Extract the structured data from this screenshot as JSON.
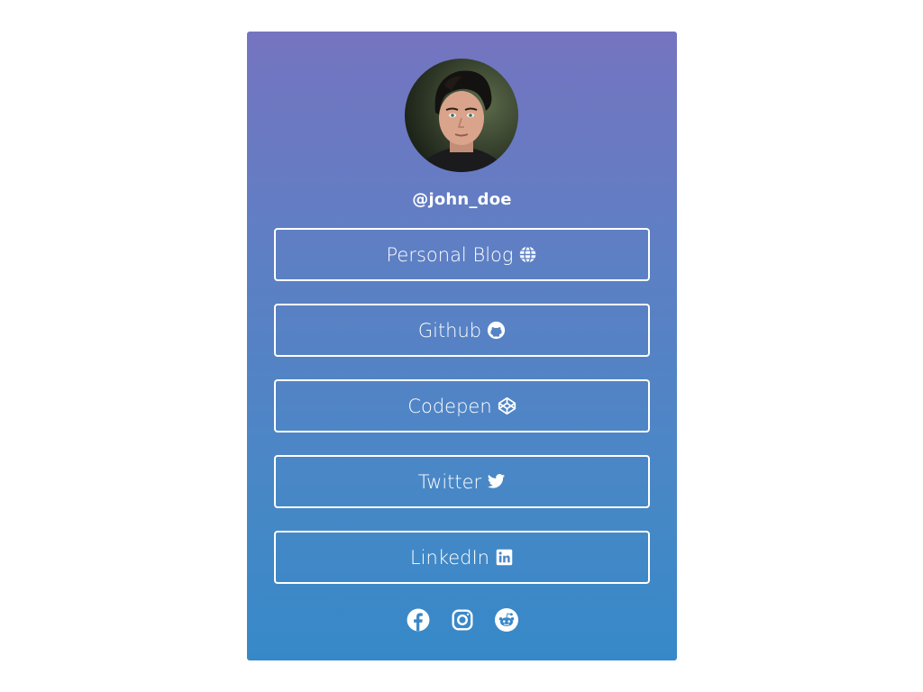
{
  "profile": {
    "username": "@john_doe",
    "avatar_alt": "profile photo"
  },
  "links": [
    {
      "label": "Personal Blog",
      "icon": "globe-icon"
    },
    {
      "label": "Github",
      "icon": "github-icon"
    },
    {
      "label": "Codepen",
      "icon": "codepen-icon"
    },
    {
      "label": "Twitter",
      "icon": "twitter-icon"
    },
    {
      "label": "LinkedIn",
      "icon": "linkedin-icon"
    }
  ],
  "social": [
    {
      "icon": "facebook-icon"
    },
    {
      "icon": "instagram-icon"
    },
    {
      "icon": "reddit-icon"
    }
  ],
  "colors": {
    "gradient_top": "#7574c0",
    "gradient_bottom": "#3689c8",
    "foreground": "#ffffff"
  }
}
